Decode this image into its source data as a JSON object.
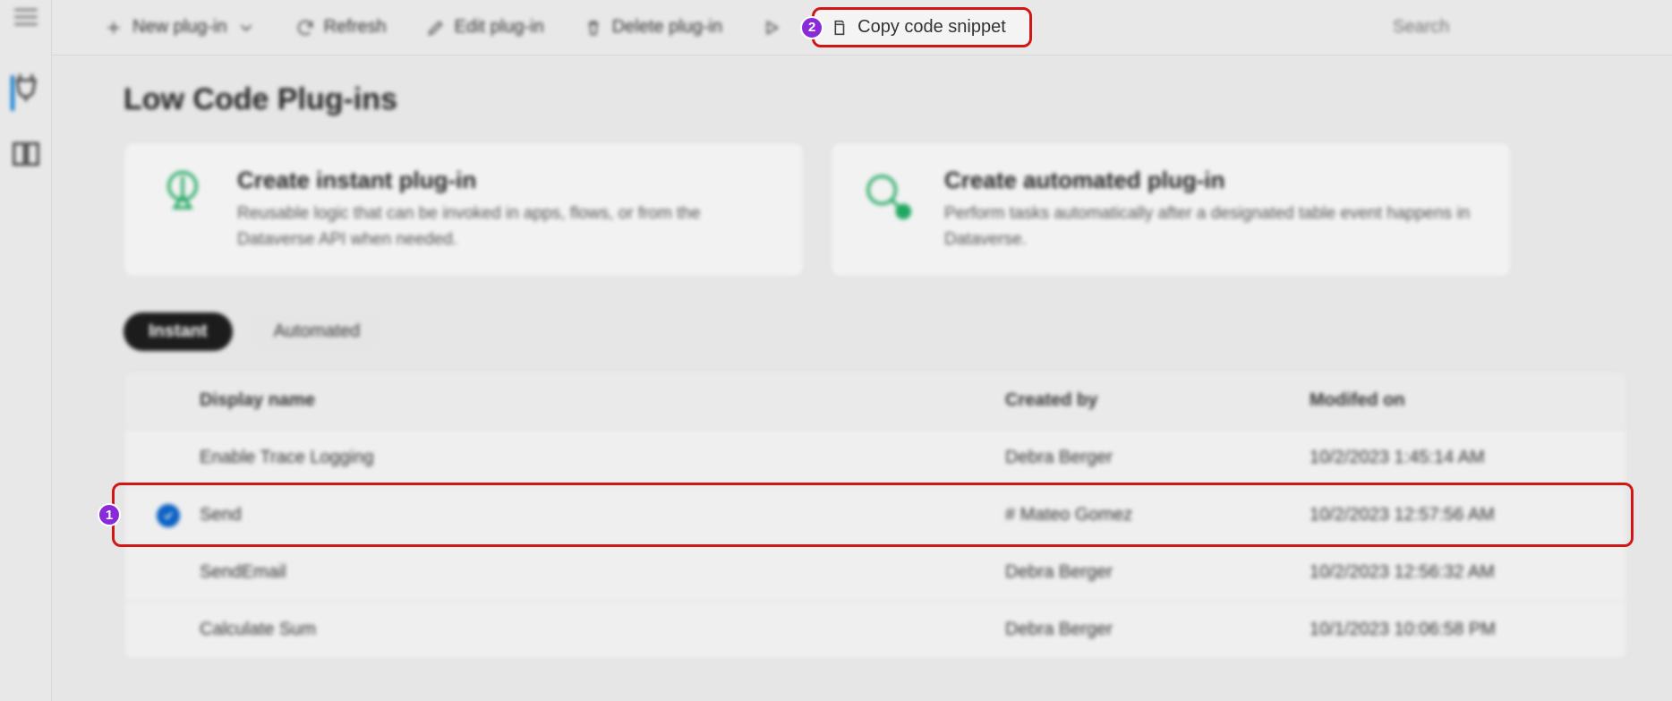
{
  "toolbar": {
    "new_plugin": "New plug-in",
    "refresh": "Refresh",
    "edit_plugin": "Edit plug-in",
    "delete_plugin": "Delete plug-in",
    "copy_snippet": "Copy code snippet",
    "search_placeholder": "Search"
  },
  "badges": {
    "step1": "1",
    "step2": "2"
  },
  "page": {
    "title": "Low Code Plug-ins"
  },
  "cards": {
    "instant": {
      "title": "Create instant plug-in",
      "desc": "Reusable logic that can be invoked in apps, flows, or from the Dataverse API when needed."
    },
    "automated": {
      "title": "Create automated plug-in",
      "desc": "Perform tasks automatically after a designated table event happens in Dataverse."
    }
  },
  "tabs": {
    "instant": "Instant",
    "automated": "Automated"
  },
  "table": {
    "headers": {
      "name": "Display name",
      "created": "Created by",
      "modified": "Modifed on"
    },
    "rows": [
      {
        "name": "Enable Trace Logging",
        "created": "Debra Berger",
        "modified": "10/2/2023 1:45:14 AM",
        "selected": false
      },
      {
        "name": "Send",
        "created": "# Mateo Gomez",
        "modified": "10/2/2023 12:57:56 AM",
        "selected": true
      },
      {
        "name": "SendEmail",
        "created": "Debra Berger",
        "modified": "10/2/2023 12:56:32 AM",
        "selected": false
      },
      {
        "name": "Calculate Sum",
        "created": "Debra Berger",
        "modified": "10/1/2023 10:06:58 PM",
        "selected": false
      }
    ]
  }
}
